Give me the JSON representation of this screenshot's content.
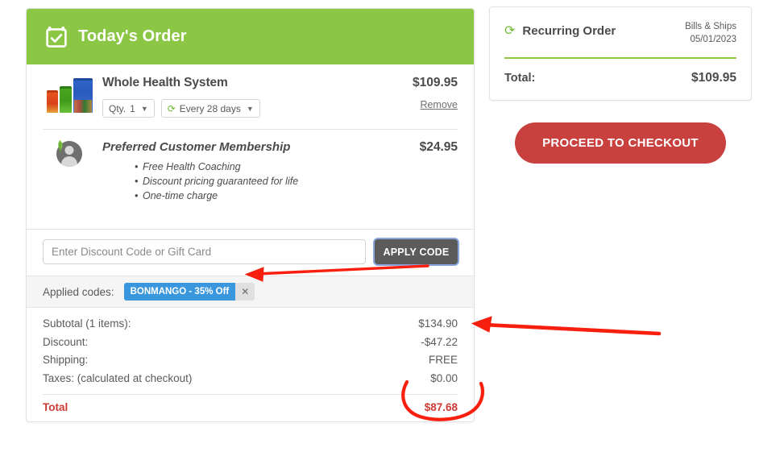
{
  "order_card": {
    "header": {
      "title": "Today's Order",
      "icon": "calendar-check-icon",
      "bg_color": "#8cc645"
    },
    "items": [
      {
        "name": "Whole Health System",
        "price": "$109.95",
        "qty_label": "Qty.",
        "qty_value": "1",
        "frequency": "Every 28 days",
        "remove_label": "Remove"
      }
    ],
    "membership": {
      "name": "Preferred Customer Membership",
      "price": "$24.95",
      "benefits": [
        "Free Health Coaching",
        "Discount pricing guaranteed for life",
        "One-time charge"
      ]
    },
    "discount": {
      "placeholder": "Enter Discount Code or Gift Card",
      "value": "",
      "apply_label": "APPLY CODE"
    },
    "applied": {
      "label": "Applied codes:",
      "code": "BONMANGO - 35% Off",
      "remove_icon": "close-icon",
      "chip_color": "#3a96dd"
    },
    "totals": {
      "rows": [
        {
          "label": "Subtotal (1 items):",
          "value": "$134.90"
        },
        {
          "label": "Discount:",
          "value": "-$47.22"
        },
        {
          "label": "Shipping:",
          "value": "FREE"
        },
        {
          "label": "Taxes: (calculated at checkout)",
          "value": "$0.00"
        }
      ],
      "total_label": "Total",
      "total_value": "$87.68",
      "total_color": "#cc3b33"
    }
  },
  "recurring_card": {
    "title": "Recurring Order",
    "icon": "recycle-icon",
    "meta_line1": "Bills & Ships",
    "meta_line2": "05/01/2023",
    "total_label": "Total:",
    "total_value": "$109.95",
    "divider_color": "#8cc645"
  },
  "checkout": {
    "label": "PROCEED TO CHECKOUT",
    "color": "#c8413f"
  },
  "annotations": {
    "color": "#f81f0e",
    "arrow_to_applied_code": "arrow-pointing-left-at-applied-code",
    "arrow_to_discount": "arrow-pointing-left-at-discount-amount",
    "circle_around_total": "hand-drawn-circle-around-total"
  }
}
